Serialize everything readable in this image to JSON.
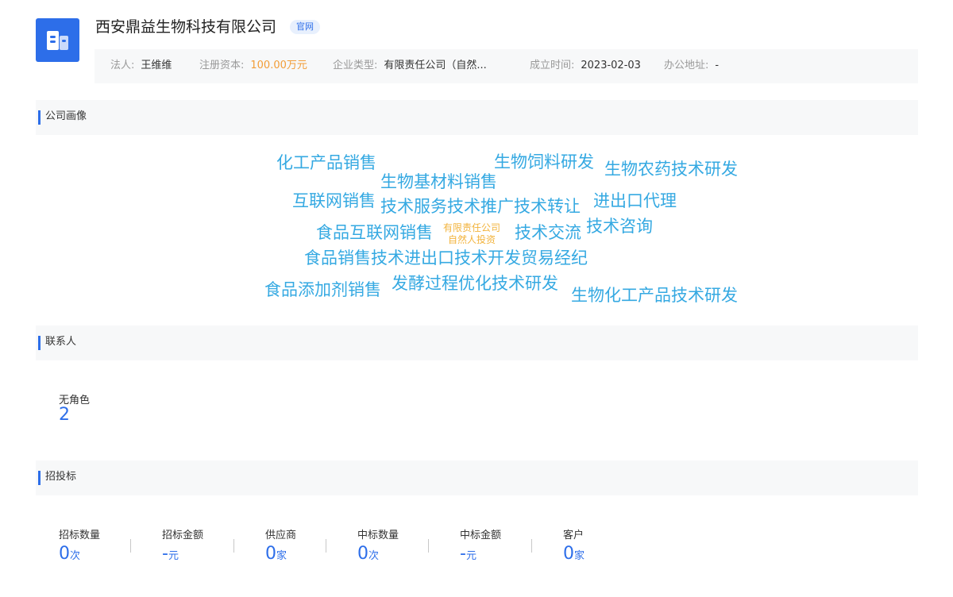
{
  "company": {
    "name": "西安鼎益生物科技有限公司",
    "badge": "官网",
    "logo_icon": "building-icon",
    "brand_color": "#2d6ee9"
  },
  "info": {
    "legal_person_label": "法人:",
    "legal_person": "王维维",
    "capital_label": "注册资本:",
    "capital": "100.00万元",
    "type_label": "企业类型:",
    "type": "有限责任公司（自然...",
    "founded_label": "成立时间:",
    "founded": "2023-02-03",
    "address_label": "办公地址:",
    "address": "-"
  },
  "portrait": {
    "title": "公司画像",
    "tags": [
      "化工产品销售",
      "生物饲料研发",
      "生物农药技术研发",
      "生物基材料销售",
      "互联网销售",
      "技术服务技术推广技术转让",
      "进出口代理",
      "技术咨询",
      "食品互联网销售",
      "技术交流",
      "食品销售技术进出口技术开发贸易经纪",
      "发酵过程优化技术研发",
      "食品添加剂销售",
      "生物化工产品技术研发"
    ],
    "center_tag": {
      "line1": "有限责任公司",
      "line2": "自然人投资"
    }
  },
  "contacts": {
    "title": "联系人",
    "role": "无角色",
    "count": "2"
  },
  "bidding": {
    "title": "招投标",
    "stats": [
      {
        "label": "招标数量",
        "value": "0",
        "unit": "次"
      },
      {
        "label": "招标金额",
        "value": "-",
        "unit": "元"
      },
      {
        "label": "供应商",
        "value": "0",
        "unit": "家"
      },
      {
        "label": "中标数量",
        "value": "0",
        "unit": "次"
      },
      {
        "label": "中标金额",
        "value": "-",
        "unit": "元"
      },
      {
        "label": "客户",
        "value": "0",
        "unit": "家"
      }
    ]
  }
}
